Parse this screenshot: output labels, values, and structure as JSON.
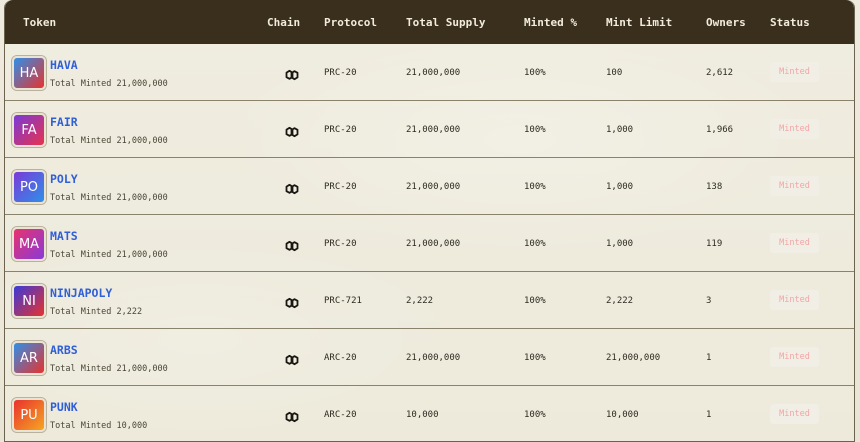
{
  "columns": {
    "token": "Token",
    "chain": "Chain",
    "protocol": "Protocol",
    "total_supply": "Total Supply",
    "minted_pct": "Minted %",
    "mint_limit": "Mint Limit",
    "owners": "Owners",
    "status": "Status"
  },
  "chain_icon": "polygon-icon",
  "rows": [
    {
      "initials": "HA",
      "name": "HAVA",
      "sub": "Total Minted 21,000,000",
      "protocol": "PRC-20",
      "supply": "21,000,000",
      "minted": "100%",
      "limit": "100",
      "owners": "2,612",
      "status": "Minted",
      "grad_from": "#2f8fe8",
      "grad_to": "#e8322e"
    },
    {
      "initials": "FA",
      "name": "FAIR",
      "sub": "Total Minted 21,000,000",
      "protocol": "PRC-20",
      "supply": "21,000,000",
      "minted": "100%",
      "limit": "1,000",
      "owners": "1,966",
      "status": "Minted",
      "grad_from": "#7a3ad8",
      "grad_to": "#e8324e"
    },
    {
      "initials": "PO",
      "name": "POLY",
      "sub": "Total Minted 21,000,000",
      "protocol": "PRC-20",
      "supply": "21,000,000",
      "minted": "100%",
      "limit": "1,000",
      "owners": "138",
      "status": "Minted",
      "grad_from": "#7a3ad8",
      "grad_to": "#2f8fe8"
    },
    {
      "initials": "MA",
      "name": "MATS",
      "sub": "Total Minted 21,000,000",
      "protocol": "PRC-20",
      "supply": "21,000,000",
      "minted": "100%",
      "limit": "1,000",
      "owners": "119",
      "status": "Minted",
      "grad_from": "#e8326e",
      "grad_to": "#8a3ad8"
    },
    {
      "initials": "NI",
      "name": "NINJAPOLY",
      "sub": "Total Minted 2,222",
      "protocol": "PRC-721",
      "supply": "2,222",
      "minted": "100%",
      "limit": "2,222",
      "owners": "3",
      "status": "Minted",
      "grad_from": "#3a3ad8",
      "grad_to": "#e8322e"
    },
    {
      "initials": "AR",
      "name": "ARBS",
      "sub": "Total Minted 21,000,000",
      "protocol": "ARC-20",
      "supply": "21,000,000",
      "minted": "100%",
      "limit": "21,000,000",
      "owners": "1",
      "status": "Minted",
      "grad_from": "#2f8fe8",
      "grad_to": "#e8322e"
    },
    {
      "initials": "PU",
      "name": "PUNK",
      "sub": "Total Minted 10,000",
      "protocol": "ARC-20",
      "supply": "10,000",
      "minted": "100%",
      "limit": "10,000",
      "owners": "1",
      "status": "Minted",
      "grad_from": "#e8322e",
      "grad_to": "#f5a623"
    }
  ]
}
